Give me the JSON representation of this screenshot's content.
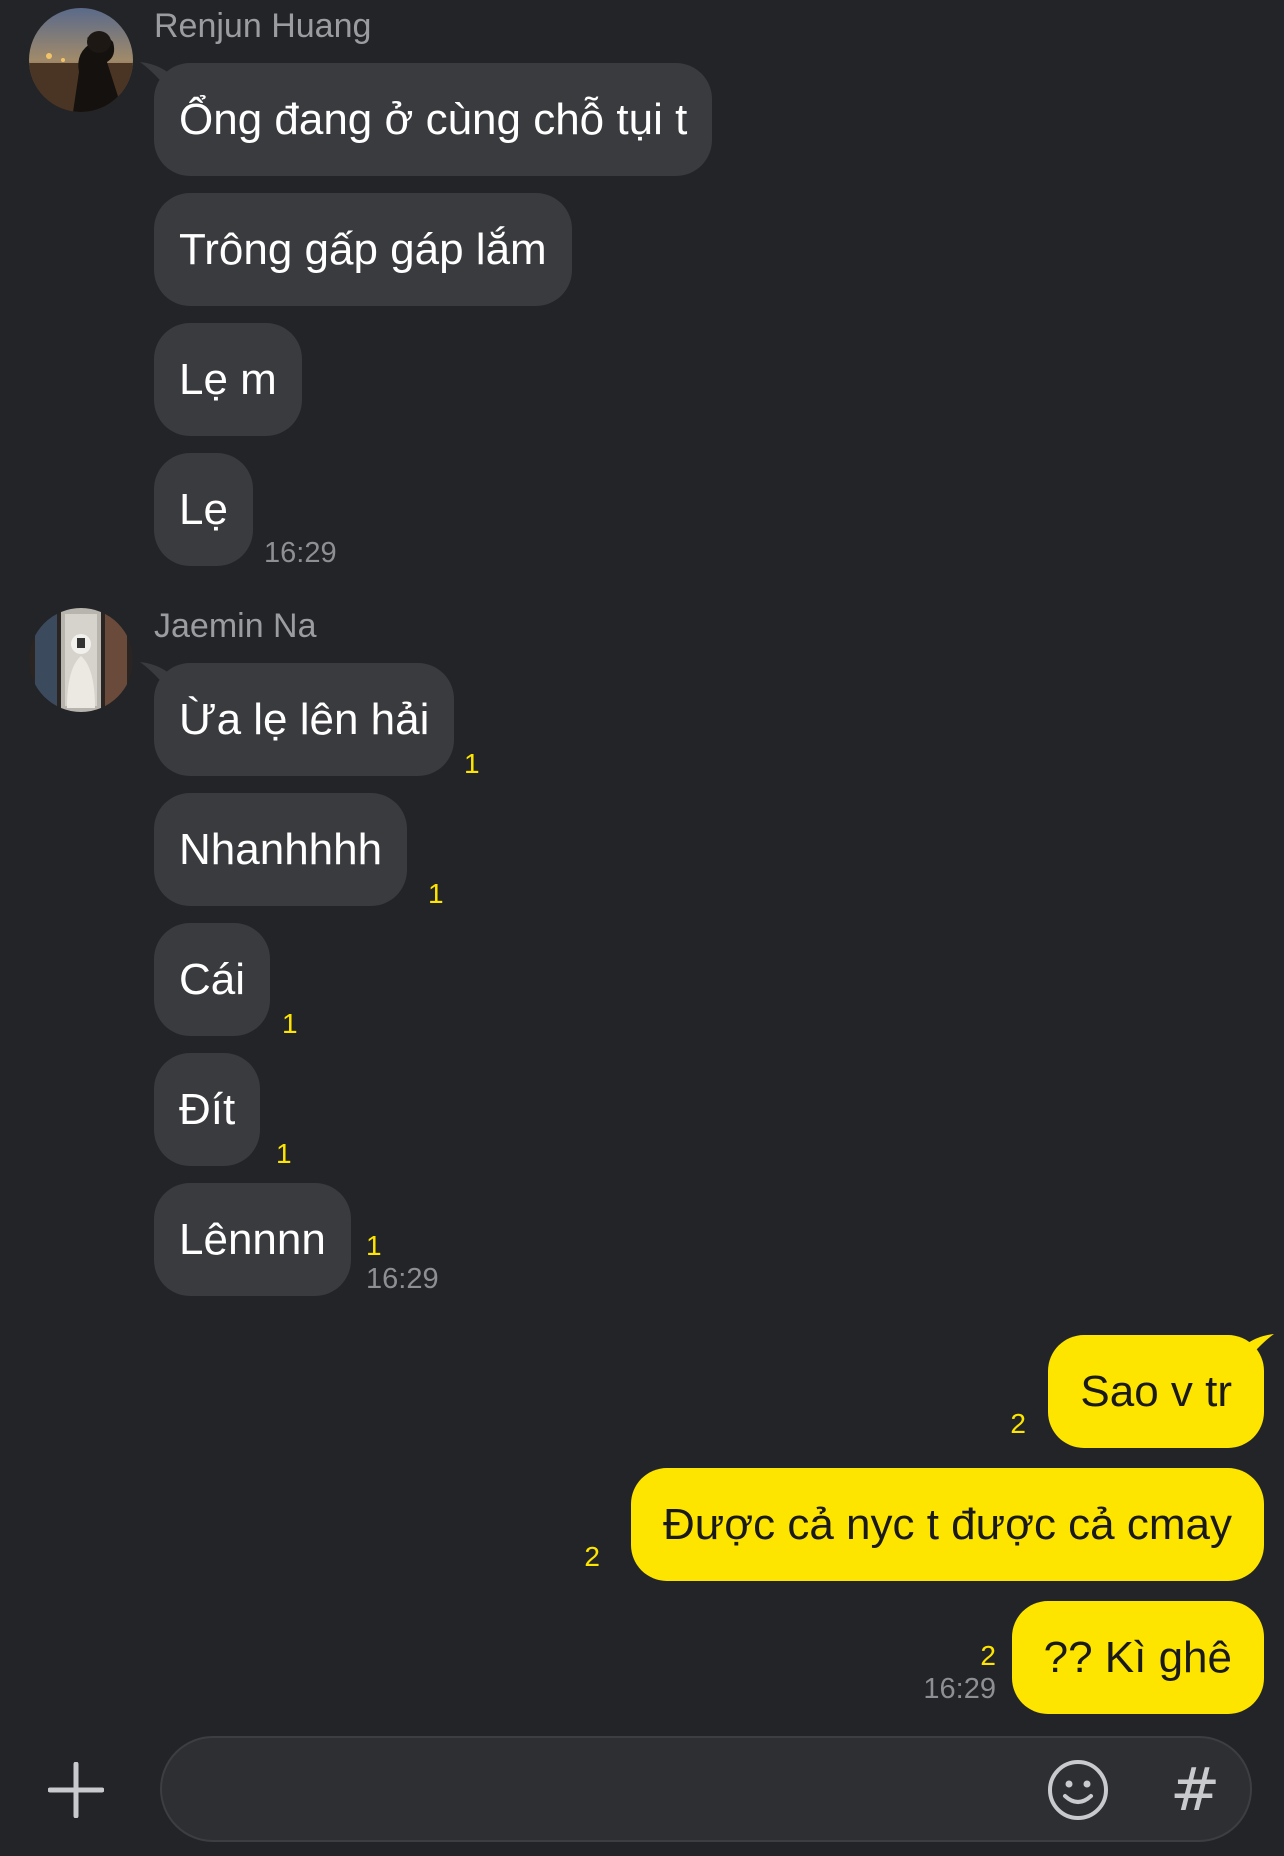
{
  "groups": [
    {
      "sender": "Renjun Huang",
      "messages": [
        {
          "text": "Ổng đang ở cùng chỗ tụi t"
        },
        {
          "text": "Trông gấp gáp lắm"
        },
        {
          "text": "Lẹ m"
        },
        {
          "text": "Lẹ",
          "time": "16:29"
        }
      ]
    },
    {
      "sender": "Jaemin Na",
      "messages": [
        {
          "text": "Ừa lẹ lên hải",
          "unread": "1"
        },
        {
          "text": "Nhanhhhh",
          "unread": "1"
        },
        {
          "text": "Cái",
          "unread": "1"
        },
        {
          "text": "Đít",
          "unread": "1"
        },
        {
          "text": "Lênnnn",
          "unread": "1",
          "time": "16:29"
        }
      ]
    }
  ],
  "my_messages": [
    {
      "text": "Sao v tr",
      "unread": "2"
    },
    {
      "text": "Được cả nyc t được cả cmay",
      "unread": "2"
    },
    {
      "text": "?? Kì ghê",
      "unread": "2",
      "time": "16:29"
    }
  ],
  "composer": {
    "value": "",
    "placeholder": "",
    "plus_icon": "plus-icon",
    "emoji_icon": "smiley-icon",
    "hash_label": "#"
  },
  "colors": {
    "background": "#232427",
    "incoming_bubble": "#3a3b3f",
    "outgoing_bubble": "#fee500",
    "unread_count": "#fee500",
    "timestamp": "#8e8f93"
  }
}
